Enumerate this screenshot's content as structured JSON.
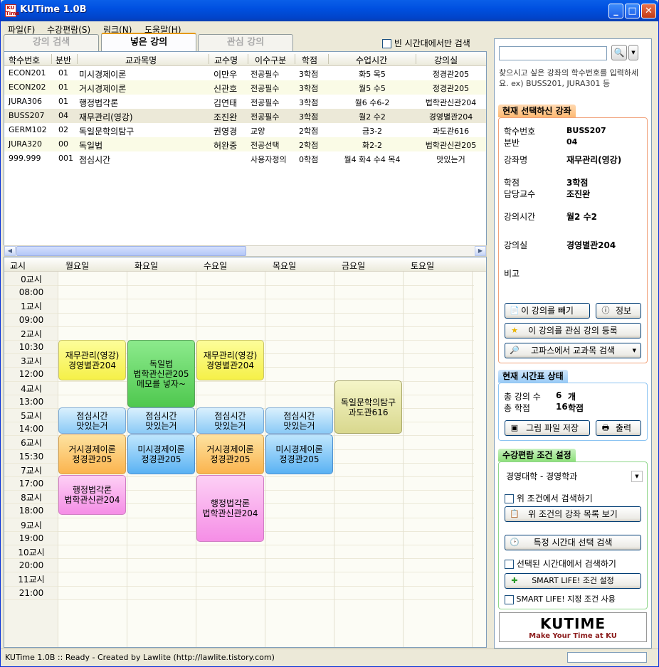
{
  "window": {
    "title": "KUTime 1.0B",
    "icon_text": "KU Time"
  },
  "menu": [
    "파일(F)",
    "수강편람(S)",
    "링크(N)",
    "도움말(H)"
  ],
  "tabs": [
    "강의 검색",
    "넣은 강의",
    "관심 강의"
  ],
  "empty_only_label": "빈 시간대에서만 검색",
  "table": {
    "columns": [
      "학수번호",
      "분반",
      "교과목명",
      "교수명",
      "이수구분",
      "학점",
      "수업시간",
      "강의실"
    ],
    "rows": [
      [
        "ECON201",
        "01",
        "미시경제이론",
        "이만우",
        "전공필수",
        "3학점",
        "화5 목5",
        "정경관205"
      ],
      [
        "ECON202",
        "01",
        "거시경제이론",
        "신관호",
        "전공필수",
        "3학점",
        "월5 수5",
        "정경관205"
      ],
      [
        "JURA306",
        "01",
        "행정법각론",
        "김연태",
        "전공필수",
        "3학점",
        "월6 수6-2",
        "법학관신관204"
      ],
      [
        "BUSS207",
        "04",
        "재무관리(영강)",
        "조진완",
        "전공필수",
        "3학점",
        "월2 수2",
        "경영별관204"
      ],
      [
        "GERM102",
        "02",
        "독일문학의탐구",
        "권영경",
        "교양",
        "2학점",
        "금3-2",
        "과도관616"
      ],
      [
        "JURA320",
        "00",
        "독일법",
        "허완중",
        "전공선택",
        "2학점",
        "화2-2",
        "법학관신관205"
      ],
      [
        "999.999",
        "001",
        "점심시간",
        "",
        "사용자정의",
        "0학점",
        "월4 화4 수4 목4",
        "맛있는거"
      ]
    ]
  },
  "timetable": {
    "days": [
      "교시",
      "월요일",
      "화요일",
      "수요일",
      "목요일",
      "금요일",
      "토요일"
    ],
    "times": [
      "0교시",
      "08:00",
      "1교시",
      "09:00",
      "2교시",
      "10:30",
      "3교시",
      "12:00",
      "4교시",
      "13:00",
      "5교시",
      "14:00",
      "6교시",
      "15:30",
      "7교시",
      "17:00",
      "8교시",
      "18:00",
      "9교시",
      "19:00",
      "10교시",
      "20:00",
      "11교시",
      "21:00"
    ],
    "blocks": [
      {
        "name": "재무관리(영강)",
        "room": "경영별관204",
        "memo": ""
      },
      {
        "name": "독일법",
        "room": "법학관신관205",
        "memo": "메모를 넣자~"
      },
      {
        "name": "재무관리(영강)",
        "room": "경영별관204",
        "memo": ""
      },
      {
        "name": "독일문학의탐구",
        "room": "과도관616",
        "memo": ""
      },
      {
        "name": "점심시간",
        "room": "맛있는거",
        "memo": ""
      },
      {
        "name": "점심시간",
        "room": "맛있는거",
        "memo": ""
      },
      {
        "name": "점심시간",
        "room": "맛있는거",
        "memo": ""
      },
      {
        "name": "점심시간",
        "room": "맛있는거",
        "memo": ""
      },
      {
        "name": "거시경제이론",
        "room": "정경관205",
        "memo": ""
      },
      {
        "name": "미시경제이론",
        "room": "정경관205",
        "memo": ""
      },
      {
        "name": "거시경제이론",
        "room": "정경관205",
        "memo": ""
      },
      {
        "name": "미시경제이론",
        "room": "정경관205",
        "memo": ""
      },
      {
        "name": "행정법각론",
        "room": "법학관신관204",
        "memo": ""
      },
      {
        "name": "행정법각론",
        "room": "법학관신관204",
        "memo": ""
      }
    ]
  },
  "right": {
    "search_value": "",
    "hint": "찾으시고 싶은 강좌의 학수번호를 입력하세요. ex) BUSS201, JURA301 등",
    "current": {
      "title": "현재 선택하신 강좌",
      "code_label": "학수번호",
      "code": "BUSS207",
      "sec_label": "분반",
      "sec": "04",
      "name_label": "강좌명",
      "name": "재무관리(영강)",
      "credit_label": "학점",
      "credit": "3학점",
      "prof_label": "담당교수",
      "prof": "조진완",
      "time_label": "강의시간",
      "time": "월2 수2",
      "room_label": "강의실",
      "room": "경영별관204",
      "note_label": "비고",
      "btn_remove": "이 강의를 빼기",
      "btn_info": "정보",
      "btn_fav": "이 강의를 관심 강의 등록",
      "btn_kopas": "고파스에서 교과목 검색"
    },
    "status": {
      "title": "현재 시간표 상태",
      "count_label": "총 강의 수",
      "count": "6",
      "count_unit": "개",
      "credit_label": "총 학점",
      "credit": "16",
      "credit_unit": "학점",
      "btn_save": "그림 파일 저장",
      "btn_print": "출력"
    },
    "cond": {
      "title": "수강편람 조건 설정",
      "dept": "경영대학 - 경영학과",
      "chk_search": "위 조건에서 검색하기",
      "btn_list": "위 조건의 강좌 목록 보기",
      "btn_time": "특정 시간대 선택 검색",
      "chk_time": "선택된 시간대에서 검색하기",
      "btn_smart": "SMART LIFE! 조건 설정",
      "chk_smart": "SMART LIFE! 지정 조건 사용"
    },
    "logo": {
      "title": "KUTIME",
      "tagline": "Make Your Time at KU"
    }
  },
  "statusbar": "KUTime 1.0B :: Ready - Created by Lawlite (http://lawlite.tistory.com)"
}
